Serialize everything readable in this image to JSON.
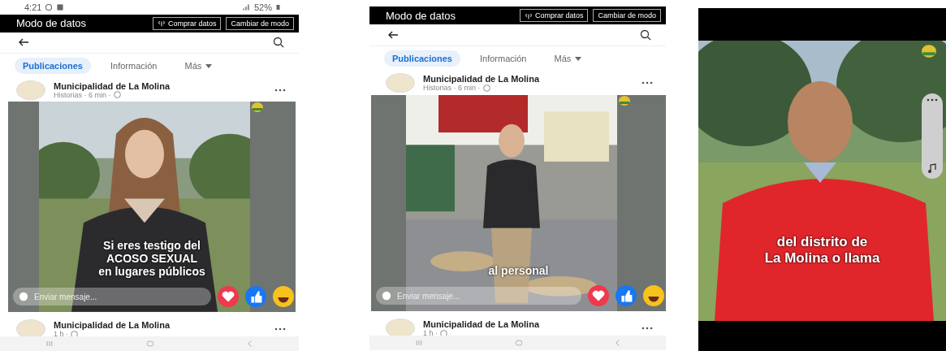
{
  "phones": [
    {
      "status_bar": {
        "time": "4:21",
        "battery": "52%"
      },
      "data_bar": {
        "title": "Modo de datos",
        "buttons": [
          "Comprar datos",
          "Cambiar de modo"
        ]
      },
      "tabs": [
        {
          "label": "Publicaciones",
          "selected": true
        },
        {
          "label": "Información",
          "selected": false
        },
        {
          "label": "Más",
          "selected": false
        }
      ],
      "post": {
        "author": "Municipalidad de La Molina",
        "meta": "Historias · 6 min ·"
      },
      "story": {
        "caption": [
          "Si eres testigo del",
          "ACOSO SEXUAL",
          "en lugares públicos"
        ],
        "message_placeholder": "Enviar mensaje..."
      },
      "next_post": {
        "author": "Municipalidad de La Molina",
        "meta": "1 h ·"
      }
    },
    {
      "data_bar": {
        "title": "Modo de datos",
        "buttons": [
          "Comprar datos",
          "Cambiar de modo"
        ]
      },
      "tabs": [
        {
          "label": "Publicaciones",
          "selected": true
        },
        {
          "label": "Información",
          "selected": false
        },
        {
          "label": "Más",
          "selected": false
        }
      ],
      "post": {
        "author": "Municipalidad de La Molina",
        "meta": "Historias · 6 min ·"
      },
      "story": {
        "caption": [
          "al personal"
        ],
        "message_placeholder": "Enviar mensaje..."
      },
      "next_post": {
        "author": "Municipalidad de La Molina",
        "meta": "1 h ·"
      }
    }
  ],
  "video": {
    "caption": [
      "del distrito de",
      "La Molina o llama"
    ]
  }
}
